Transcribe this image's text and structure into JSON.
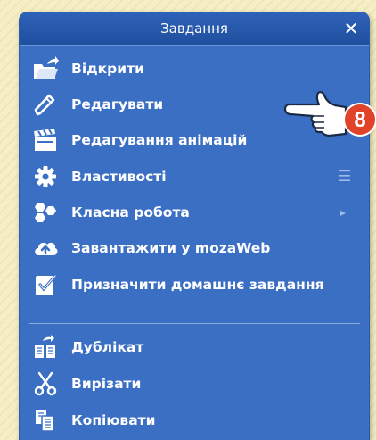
{
  "panel": {
    "title": "Завдання",
    "close_symbol": "✕"
  },
  "menu": {
    "items": [
      {
        "label": "Відкрити",
        "icon": "open-folder-icon"
      },
      {
        "label": "Редагувати",
        "icon": "pencil-icon"
      },
      {
        "label": "Редагування анімацій",
        "icon": "clapperboard-icon"
      },
      {
        "label": "Властивості",
        "icon": "gear-icon",
        "suffix": "☰"
      },
      {
        "label": "Класна робота",
        "icon": "hexagons-icon",
        "suffix": "▸"
      },
      {
        "label": "Завантажити у mozaWeb",
        "icon": "cloud-upload-icon"
      },
      {
        "label": "Призначити домашнє завдання",
        "icon": "assign-homework-icon"
      },
      {
        "label": "Дублікат",
        "icon": "duplicate-icon"
      },
      {
        "label": "Вирізати",
        "icon": "scissors-icon"
      },
      {
        "label": "Копіювати",
        "icon": "copy-icon"
      }
    ]
  },
  "callout": {
    "number": "8",
    "badge_color": "#e0432a"
  }
}
